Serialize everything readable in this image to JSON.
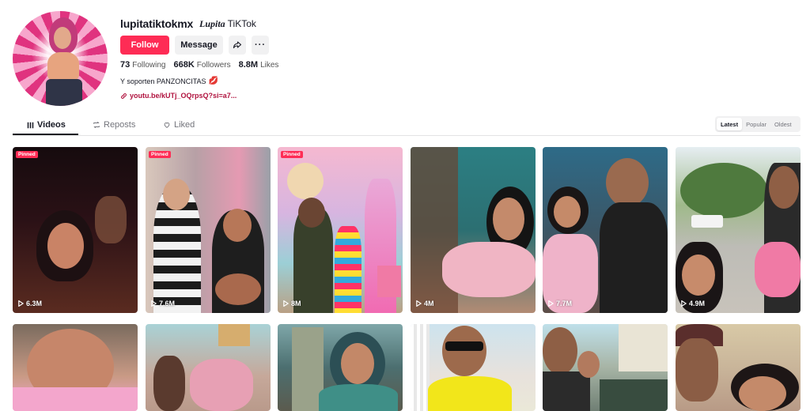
{
  "profile": {
    "username": "lupitatiktokmx",
    "nickname_fancy": "Lupita",
    "nickname_rest": "TiKTok",
    "follow_label": "Follow",
    "message_label": "Message",
    "more_label": "···",
    "stats": {
      "following_count": "73",
      "following_label": "Following",
      "followers_count": "668K",
      "followers_label": "Followers",
      "likes_count": "8.8M",
      "likes_label": "Likes"
    },
    "bio": "Y soporten PANZONCITAS",
    "bio_emoji": "💋",
    "link": "youtu.be/kUTj_OQrpsQ?si=a7..."
  },
  "tabs": {
    "videos": "Videos",
    "reposts": "Reposts",
    "liked": "Liked"
  },
  "sort": {
    "latest": "Latest",
    "popular": "Popular",
    "oldest": "Oldest"
  },
  "videos": [
    {
      "pinned": "Pinned",
      "views": "6.3M"
    },
    {
      "pinned": "Pinned",
      "views": "7.6M"
    },
    {
      "pinned": "Pinned",
      "views": "8M"
    },
    {
      "pinned": "",
      "views": "4M"
    },
    {
      "pinned": "",
      "views": "7.7M"
    },
    {
      "pinned": "",
      "views": "4.9M"
    },
    {
      "pinned": "",
      "views": ""
    },
    {
      "pinned": "",
      "views": ""
    },
    {
      "pinned": "",
      "views": ""
    },
    {
      "pinned": "",
      "views": ""
    },
    {
      "pinned": "",
      "views": ""
    },
    {
      "pinned": "",
      "views": ""
    }
  ],
  "colors": {
    "brand": "#fe2c55",
    "text": "#161823",
    "muted": "#73747b",
    "link": "#b0123e"
  },
  "icons": {
    "share": "share-arrow-icon",
    "link": "link-icon",
    "videos_tab": "grid-icon",
    "reposts_tab": "repost-icon",
    "liked_tab": "heart-outline-icon",
    "play": "play-icon"
  }
}
